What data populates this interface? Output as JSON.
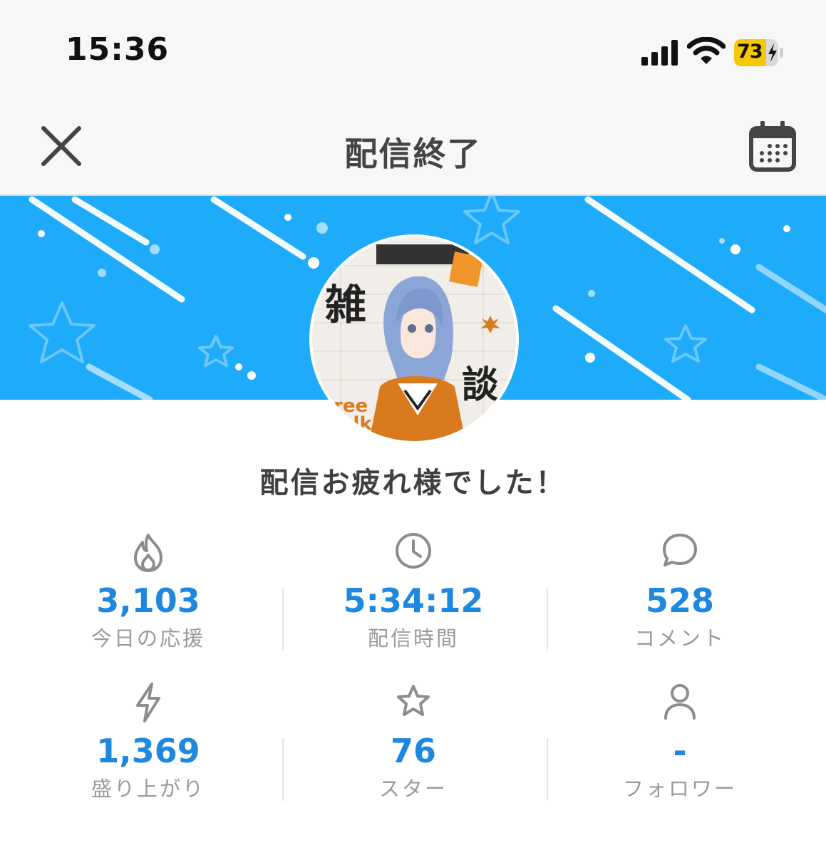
{
  "status_bar": {
    "time": "15:36",
    "battery_level": "73",
    "battery_charging": true,
    "icons": [
      "cellular-signal-icon",
      "wifi-icon",
      "battery-icon"
    ]
  },
  "nav": {
    "title": "配信終了",
    "close_icon": "close-icon",
    "calendar_icon": "calendar-icon"
  },
  "banner": {
    "background_color": "#1eabfa"
  },
  "greeting": "配信お疲れ様でした！",
  "stats": [
    {
      "icon": "flame-icon",
      "value": "3,103",
      "label": "今日の応援"
    },
    {
      "icon": "clock-icon",
      "value": "5:34:12",
      "label": "配信時間"
    },
    {
      "icon": "comment-icon",
      "value": "528",
      "label": "コメント"
    },
    {
      "icon": "lightning-icon",
      "value": "1,369",
      "label": "盛り上がり"
    },
    {
      "icon": "star-icon",
      "value": "76",
      "label": "スター"
    },
    {
      "icon": "person-icon",
      "value": "-",
      "label": "フォロワー"
    }
  ],
  "colors": {
    "accent": "#1e88e0",
    "label": "#9a9a9a",
    "battery": "#f5c800"
  }
}
